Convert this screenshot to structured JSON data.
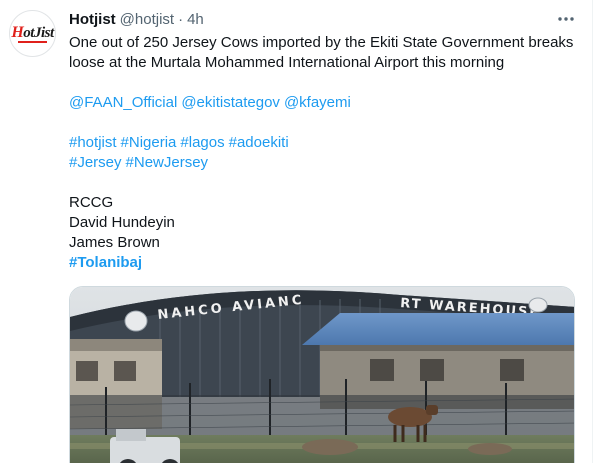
{
  "tweet": {
    "display_name": "Hotjist",
    "handle": "@hotjist",
    "separator": "·",
    "time": "4h",
    "text_line1": "One out of 250 Jersey Cows imported by the Ekiti State Government breaks",
    "text_line2": "loose at the Murtala Mohammed International Airport this morning",
    "mentions": [
      "@FAAN_Official",
      "@ekitistategov",
      "@kfayemi"
    ],
    "hashtags_line1": [
      "#hotjist",
      "#Nigeria",
      "#lagos",
      "#adoekiti"
    ],
    "hashtags_line2": [
      "#Jersey",
      "#NewJersey"
    ],
    "trends": [
      "RCCG",
      "David Hundeyin",
      "James Brown"
    ],
    "bold_hashtag": "#Tolanibaj",
    "media": {
      "sign_text": "NAHCO AVIANC    RT WAREHOUSE"
    }
  },
  "avatar": {
    "logo_text_h": "H",
    "logo_text_rest": "otJist"
  },
  "colors": {
    "link": "#1d9bf0",
    "text": "#0f1419",
    "muted": "#536471"
  },
  "icons": {
    "more": "more-horizontal-icon"
  }
}
